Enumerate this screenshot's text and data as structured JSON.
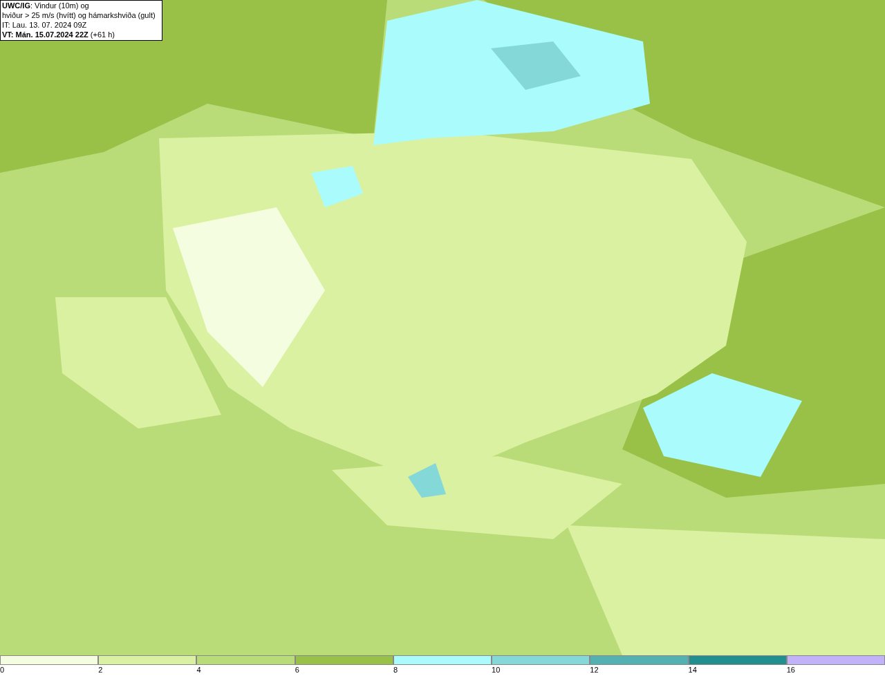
{
  "title_box": {
    "lines": [
      "**UWC/IG**: Vindur (10m) og",
      "hviður > 25 m/s (hvítt) og hámarkshviða (gult)",
      "IT: Lau. 13. 07. 2024 09Z",
      "**VT: Mán. 15.07.2024 22Z** (+61 h)"
    ]
  },
  "legend": {
    "segments": [
      {
        "color": "#f4fde0"
      },
      {
        "color": "#d9f1a0"
      },
      {
        "color": "#badc78"
      },
      {
        "color": "#99c047"
      },
      {
        "color": "#aafcfc"
      },
      {
        "color": "#84d8d8"
      },
      {
        "color": "#53b1b1"
      },
      {
        "color": "#228f8f"
      },
      {
        "color": "#c2b2f9"
      }
    ],
    "ticks": [
      "0",
      "2",
      "4",
      "6",
      "8",
      "10",
      "12",
      "14",
      "16"
    ]
  }
}
